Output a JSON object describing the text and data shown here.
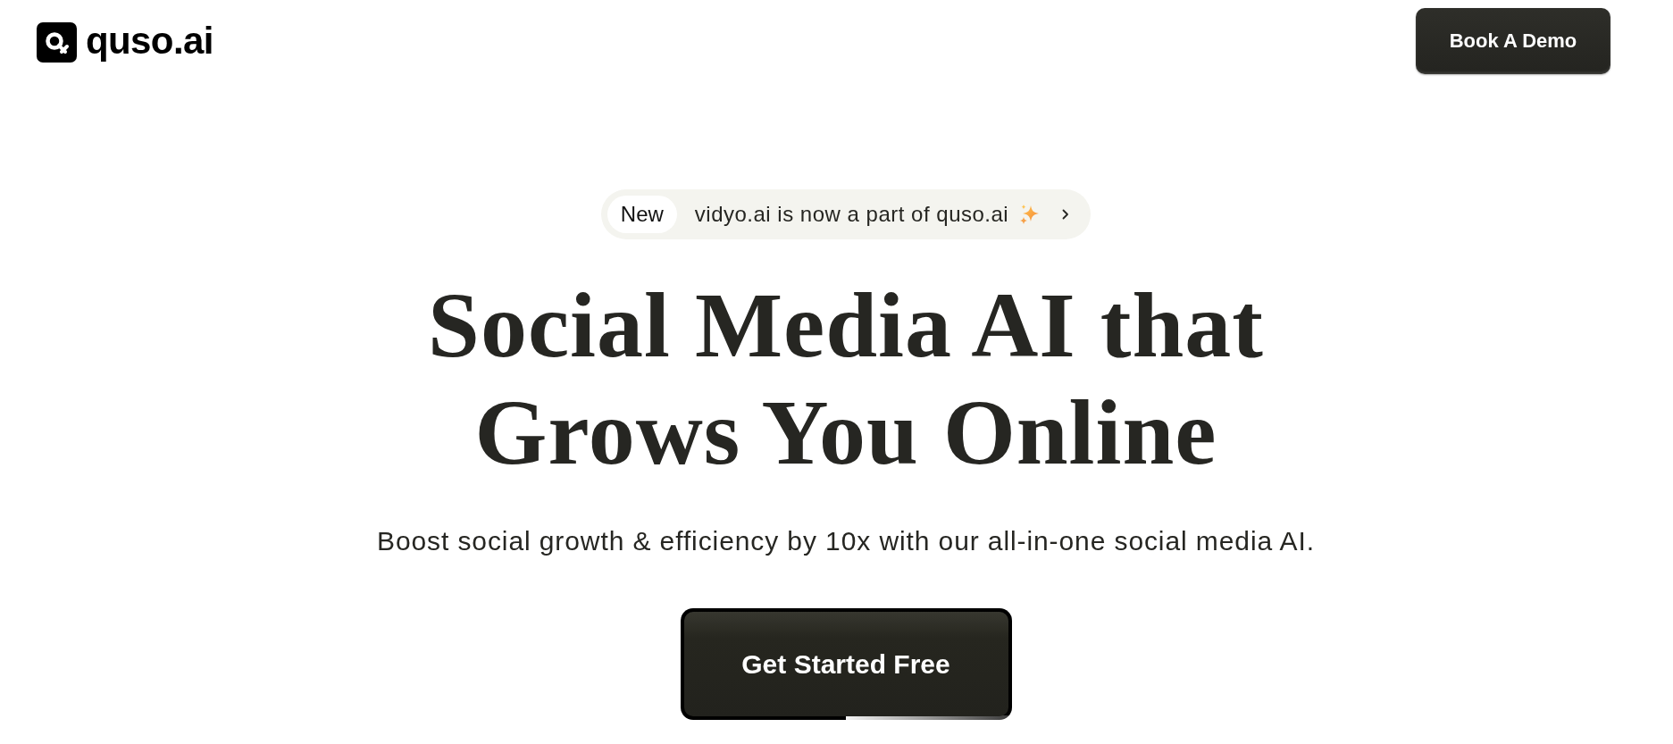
{
  "header": {
    "logo_text": "quso.ai",
    "demo_button": "Book A Demo"
  },
  "announcement": {
    "tag": "New",
    "text": "vidyo.ai is now a part of quso.ai"
  },
  "hero": {
    "title_lines": [
      "Social Media AI that",
      "Grows You Online"
    ],
    "subtitle": "Boost social growth & efficiency by 10x with our all-in-one social media AI.",
    "cta": "Get Started Free"
  }
}
